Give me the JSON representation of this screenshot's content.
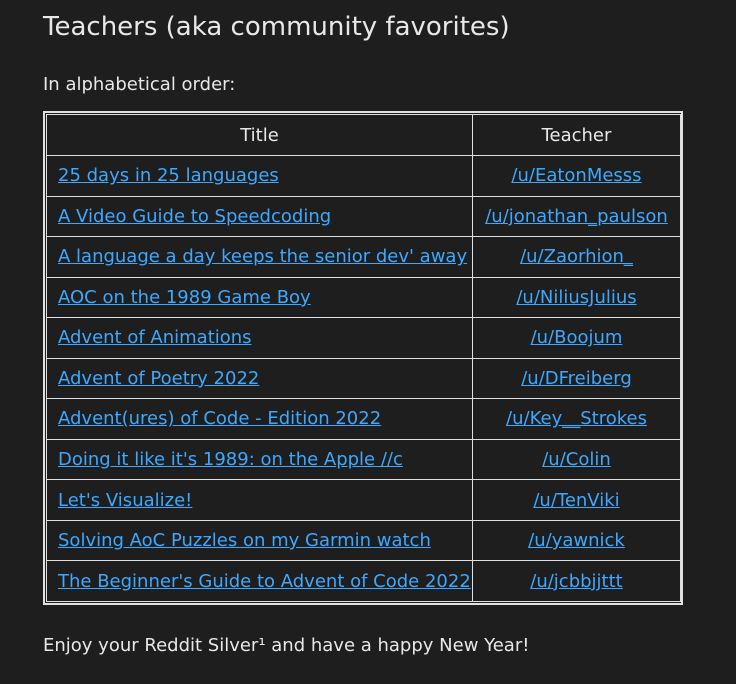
{
  "heading": "Teachers (aka community favorites)",
  "intro": "In alphabetical order:",
  "table": {
    "headers": [
      "Title",
      "Teacher"
    ],
    "rows": [
      {
        "title": "25 days in 25 languages",
        "teacher": "/u/EatonMesss"
      },
      {
        "title": "A Video Guide to Speedcoding",
        "teacher": "/u/jonathan_paulson"
      },
      {
        "title": "A language a day keeps the senior dev' away",
        "teacher": "/u/Zaorhion_"
      },
      {
        "title": "AOC on the 1989 Game Boy",
        "teacher": "/u/NiliusJulius"
      },
      {
        "title": "Advent of Animations",
        "teacher": "/u/Boojum"
      },
      {
        "title": "Advent of Poetry 2022",
        "teacher": "/u/DFreiberg"
      },
      {
        "title": "Advent(ures) of Code - Edition 2022",
        "teacher": "/u/Key__Strokes"
      },
      {
        "title": "Doing it like it's 1989: on the Apple //c",
        "teacher": "/u/Colin"
      },
      {
        "title": "Let's Visualize!",
        "teacher": "/u/TenViki"
      },
      {
        "title": "Solving AoC Puzzles on my Garmin watch",
        "teacher": "/u/yawnick"
      },
      {
        "title": "The Beginner's Guide to Advent of Code 2022",
        "teacher": "/u/jcbbjjttt"
      }
    ]
  },
  "outro": "Enjoy your Reddit Silver¹ and have a happy New Year!",
  "colors": {
    "background": "#1e1e1e",
    "text": "#e8e8e8",
    "link": "#3ea8ff",
    "border": "#e0e0e0"
  }
}
